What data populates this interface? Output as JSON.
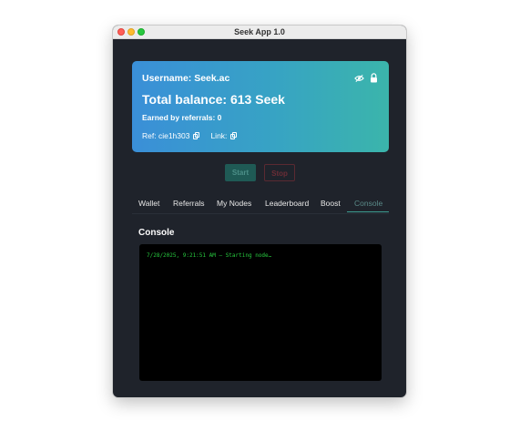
{
  "window": {
    "title": "Seek App 1.0"
  },
  "card": {
    "username": "Username: Seek.ac",
    "balance": "Total balance: 613 Seek",
    "earned": "Earned by referrals: 0",
    "ref": "Ref: cie1h303",
    "link": "Link:"
  },
  "controls": {
    "start_label": "Start",
    "stop_label": "Stop"
  },
  "tabs": [
    {
      "label": "Wallet"
    },
    {
      "label": "Referrals"
    },
    {
      "label": "My Nodes"
    },
    {
      "label": "Leaderboard"
    },
    {
      "label": "Boost"
    },
    {
      "label": "Console",
      "active": true
    }
  ],
  "console": {
    "title": "Console",
    "lines": [
      "7/28/2025, 9:21:51 AM — Starting node…"
    ]
  },
  "colors": {
    "card_gradient_start": "#3a8fd8",
    "card_gradient_end": "#3bb5ab",
    "console_text": "#27c93f",
    "active_tab_accent": "#3c9c90"
  },
  "icons": [
    "eye-slash-icon",
    "lock-icon",
    "copy-icon"
  ]
}
